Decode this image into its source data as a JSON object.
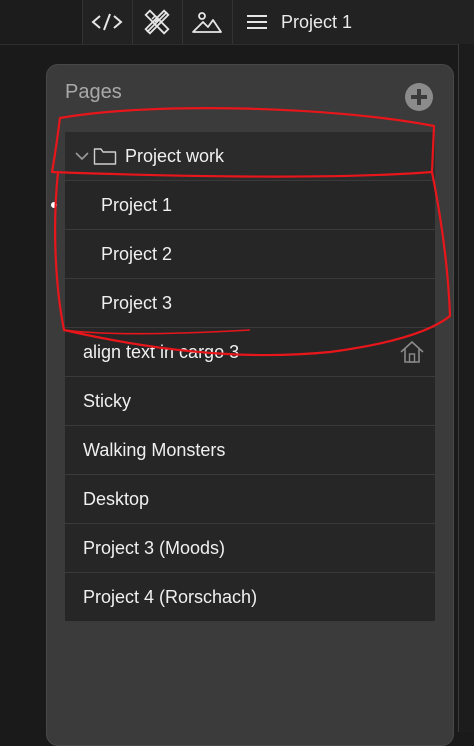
{
  "topbar": {
    "icons": [
      "code-icon",
      "design-tools-icon",
      "image-icon",
      "menu-icon"
    ],
    "title": "Project 1"
  },
  "panel": {
    "title": "Pages",
    "add_icon": "plus-circle-icon",
    "folder": {
      "label": "Project work",
      "expanded": true,
      "children": [
        {
          "label": "Project 1",
          "active": true
        },
        {
          "label": "Project 2"
        },
        {
          "label": "Project 3"
        }
      ]
    },
    "pages": [
      {
        "label": "align text in cargo 3",
        "homepage": true
      },
      {
        "label": "Sticky"
      },
      {
        "label": "Walking Monsters"
      },
      {
        "label": "Desktop"
      },
      {
        "label": "Project 3 (Moods)"
      },
      {
        "label": "Project 4 (Rorschach)"
      }
    ]
  },
  "colors": {
    "annotation": "#e8161b",
    "panel_bg": "#3b3b3b",
    "row_bg": "#262626"
  }
}
